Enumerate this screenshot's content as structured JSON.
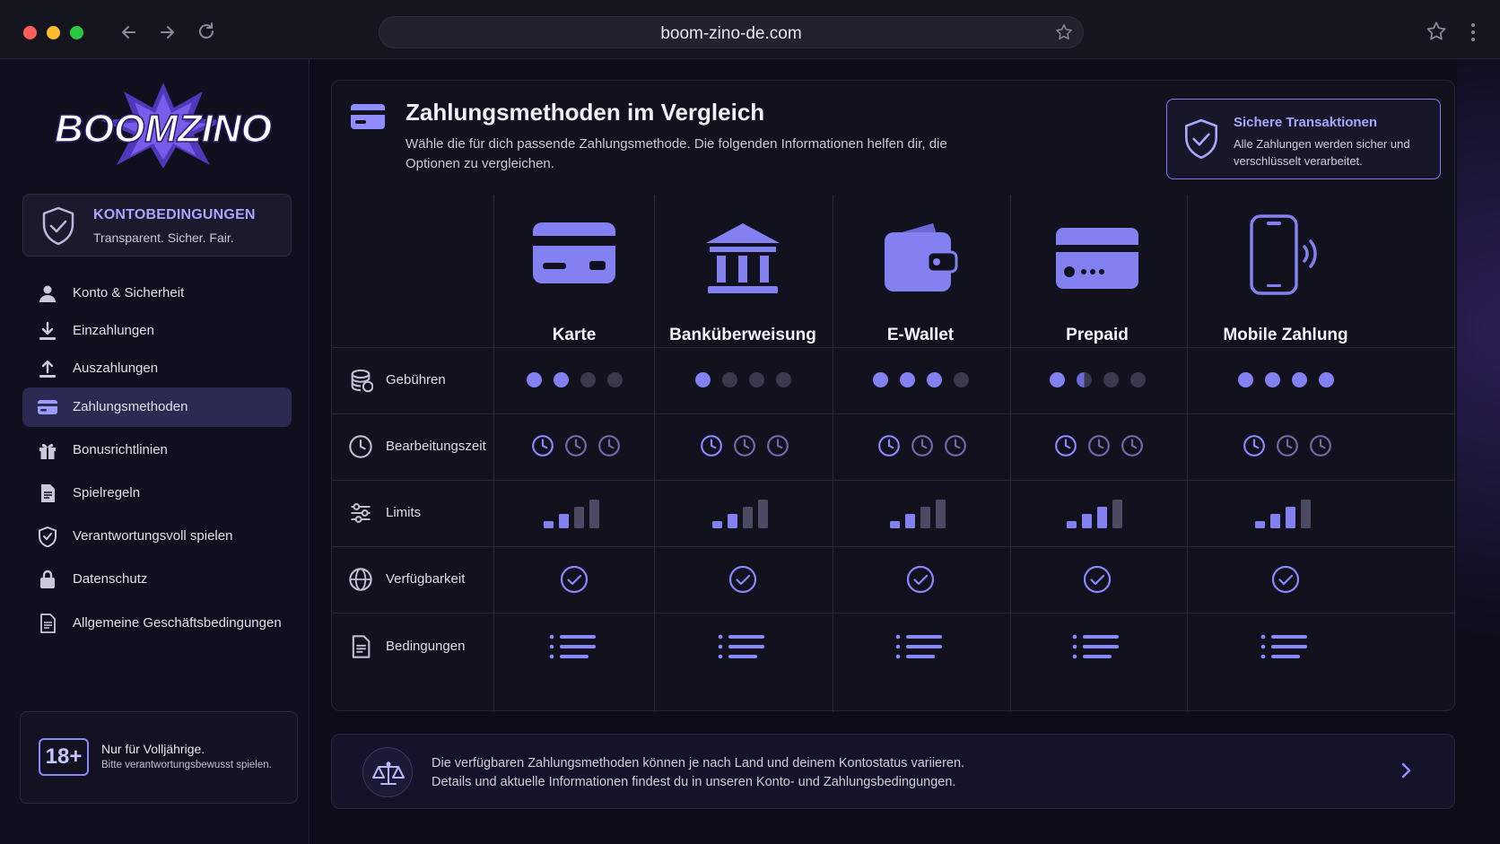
{
  "browser": {
    "url": "boom-zino-de.com",
    "traffic_lights": [
      "#ff5f57",
      "#febc2e",
      "#28c840"
    ]
  },
  "sidebar": {
    "logo_text": "BOOMZINO",
    "account_box": {
      "title": "KONTOBEDINGUNGEN",
      "subtitle": "Transparent. Sicher. Fair."
    },
    "items": [
      {
        "label": "Konto & Sicherheit",
        "icon": "user-icon",
        "active": false
      },
      {
        "label": "Einzahlungen",
        "icon": "download-icon",
        "active": false
      },
      {
        "label": "Auszahlungen",
        "icon": "upload-icon",
        "active": false
      },
      {
        "label": "Zahlungsmethoden",
        "icon": "credit-card-icon",
        "active": true
      },
      {
        "label": "Bonusrichtlinien",
        "icon": "gift-icon",
        "active": false
      },
      {
        "label": "Spielregeln",
        "icon": "document-icon",
        "active": false
      },
      {
        "label": "Verantwortungsvoll spielen",
        "icon": "shield-check-icon",
        "active": false
      },
      {
        "label": "Datenschutz",
        "icon": "lock-icon",
        "active": false
      },
      {
        "label": "Allgemeine Geschäftsbedingungen",
        "icon": "document-lines-icon",
        "active": false
      }
    ],
    "age_notice": {
      "badge": "18+",
      "line1": "Nur für Volljährige.",
      "line2": "Bitte verantwortungsbewusst spielen."
    }
  },
  "main": {
    "title": "Zahlungsmethoden im Vergleich",
    "description": "Wähle die für dich passende Zahlungsmethode. Die folgenden Informationen helfen dir, die Optionen zu vergleichen.",
    "secure": {
      "title": "Sichere Transaktionen",
      "text": "Alle Zahlungen werden sicher und verschlüsselt verarbeitet."
    },
    "columns": [
      {
        "label": "Karte",
        "icon": "credit-card-icon"
      },
      {
        "label": "Banküberweisung",
        "icon": "bank-icon"
      },
      {
        "label": "E-Wallet",
        "icon": "wallet-icon"
      },
      {
        "label": "Prepaid",
        "icon": "prepaid-card-icon"
      },
      {
        "label": "Mobile Zahlung",
        "icon": "smartphone-icon"
      }
    ],
    "rows": [
      {
        "label": "Gebühren",
        "icon": "coins-icon"
      },
      {
        "label": "Bearbeitungszeit",
        "icon": "clock-icon"
      },
      {
        "label": "Limits",
        "icon": "sliders-icon"
      },
      {
        "label": "Verfügbarkeit",
        "icon": "globe-icon"
      },
      {
        "label": "Bedingungen",
        "icon": "document-icon"
      }
    ],
    "fees_dots": [
      2,
      1,
      3,
      1.5,
      4
    ],
    "fees_scale": 4,
    "limits_level": [
      2,
      2,
      2,
      3,
      3
    ],
    "limits_scale": 4,
    "available": [
      true,
      true,
      true,
      true,
      true
    ],
    "footer": {
      "line1": "Die verfügbaren Zahlungsmethoden können je nach Land und deinem Kontostatus variieren.",
      "line2": "Details und aktuelle Informationen findest du in unseren Konto- und Zahlungsbedingungen."
    }
  },
  "colors": {
    "accent": "#8380f2",
    "accent_light": "#a9a6ff",
    "background": "#0d0d1a",
    "active_nav": "#2a2a52"
  }
}
